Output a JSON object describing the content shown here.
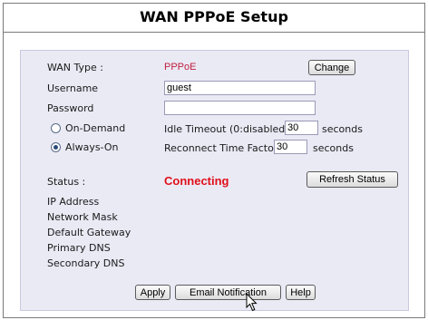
{
  "page": {
    "title": "WAN PPPoE Setup"
  },
  "form": {
    "wan_type_label": "WAN Type :",
    "wan_type_value": "PPPoE",
    "change_button": "Change",
    "username_label": "Username",
    "username_value": "guest",
    "password_label": "Password",
    "password_value": "",
    "mode_on_demand_label": "On-Demand",
    "mode_always_on_label": "Always-On",
    "selected_mode": "Always-On",
    "idle_timeout_label": "Idle Timeout (0:disabled)",
    "idle_timeout_value": "30",
    "idle_timeout_unit": "seconds",
    "reconnect_label": "Reconnect Time Factor",
    "reconnect_value": "30",
    "reconnect_unit": "seconds"
  },
  "status": {
    "label": "Status :",
    "value": "Connecting",
    "value_color": "#e0101a",
    "refresh_button": "Refresh Status",
    "fields": [
      "IP Address",
      "Network Mask",
      "Default Gateway",
      "Primary DNS",
      "Secondary DNS"
    ]
  },
  "actions": {
    "apply_button": "Apply",
    "email_button": "Email Notification",
    "help_button": "Help"
  },
  "icons": {
    "cursor": "mouse-pointer-icon"
  }
}
